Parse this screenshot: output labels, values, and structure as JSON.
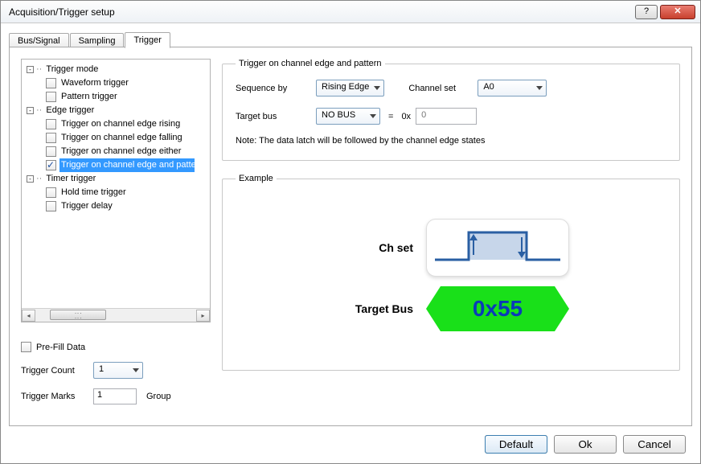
{
  "window": {
    "title": "Acquisition/Trigger setup"
  },
  "tabs": {
    "bus": "Bus/Signal",
    "sampling": "Sampling",
    "trigger": "Trigger"
  },
  "tree": {
    "trigger_mode": {
      "label": "Trigger mode",
      "waveform": "Waveform trigger",
      "pattern": "Pattern trigger"
    },
    "edge_trigger": {
      "label": "Edge trigger",
      "rising": "Trigger on channel edge rising",
      "falling": "Trigger on channel edge falling",
      "either": "Trigger on channel edge either",
      "pattern": "Trigger on channel edge and pattern"
    },
    "timer_trigger": {
      "label": "Timer trigger",
      "hold": "Hold time trigger",
      "delay": "Trigger delay"
    }
  },
  "left_form": {
    "prefill": "Pre-Fill Data",
    "trigger_count_label": "Trigger Count",
    "trigger_count_value": "1",
    "trigger_marks_label": "Trigger Marks",
    "trigger_marks_value": "1",
    "trigger_marks_unit": "Group"
  },
  "right": {
    "legend": "Trigger on channel edge and pattern",
    "sequence_by_label": "Sequence by",
    "sequence_by_value": "Rising Edge",
    "channel_set_label": "Channel set",
    "channel_set_value": "A0",
    "target_bus_label": "Target bus",
    "target_bus_value": "NO BUS",
    "equals": "=",
    "hex_prefix": "0x",
    "hex_value": "0",
    "note": "Note: The data latch will be followed by the channel edge states"
  },
  "example": {
    "legend": "Example",
    "chset_label": "Ch set",
    "target_bus_label": "Target Bus",
    "bus_value": "0x55"
  },
  "buttons": {
    "default_": "Default",
    "ok": "Ok",
    "cancel": "Cancel"
  }
}
